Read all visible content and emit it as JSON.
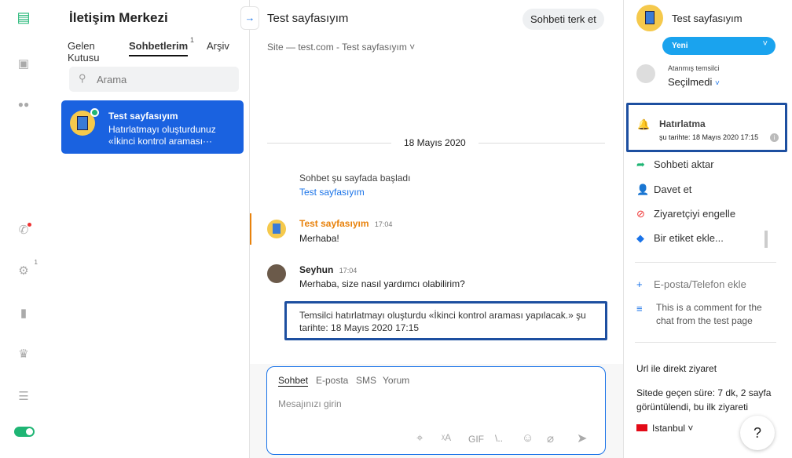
{
  "app_title": "İletişim Merkezi",
  "tabs": [
    {
      "label": "Gelen Kutusu"
    },
    {
      "label": "Sohbetlerim",
      "badge": "1"
    },
    {
      "label": "Arşiv"
    }
  ],
  "search_placeholder": "Arama",
  "conversation": {
    "name": "Test sayfasıyım",
    "line1": "Hatırlatmayı oluşturdunuz",
    "line2": "«İkinci kontrol araması···"
  },
  "rail": {
    "badge": "1"
  },
  "main": {
    "title": "Test sayfasıyım",
    "leave_button": "Sohbeti terk et",
    "site": "Site — test.com - Test sayfasıyım",
    "date": "18 Mayıs 2020",
    "started": "Sohbet şu sayfada başladı",
    "started_link": "Test sayfasıyım",
    "messages": [
      {
        "author": "Test sayfasıyım",
        "time": "17:04",
        "text": "Merhaba!"
      },
      {
        "author": "Seyhun",
        "time": "17:04",
        "text": "Merhaba, size nasıl yardımcı olabilirim?"
      }
    ],
    "system_note": "Temsilci hatırlatmayı oluşturdu «İkinci kontrol araması yapılacak.» şu tarihte: 18 Mayıs 2020 17:15"
  },
  "composer": {
    "tabs": [
      "Sohbet",
      "E-posta",
      "SMS",
      "Yorum"
    ],
    "placeholder": "Mesajınızı girin",
    "gif": "GIF",
    "snippet": "\\.."
  },
  "right": {
    "name": "Test sayfasıyım",
    "status": "Yeni",
    "assigned_label": "Atanmış temsilci",
    "assigned_value": "Seçilmedi",
    "reminder_title": "Hatırlatma",
    "reminder_date": "şu tarihte: 18 Mayıs 2020 17:15",
    "actions": [
      "Sohbeti aktar",
      "Davet et",
      "Ziyaretçiyi engelle",
      "Bir etiket ekle..."
    ],
    "add_contact": "E-posta/Telefon ekle",
    "comment": "This is a comment for the chat from the test page",
    "visit_type": "Url ile direkt ziyaret",
    "visit_info": "Sitede geçen süre: 7 dk, 2 sayfa görüntülendi, bu ilk ziyareti",
    "city": "Istanbul",
    "help": "?"
  },
  "colors": {
    "accent": "#1a73e8",
    "green": "#1fb574",
    "orange": "#e8820c",
    "highlight": "#1d4fa0"
  }
}
